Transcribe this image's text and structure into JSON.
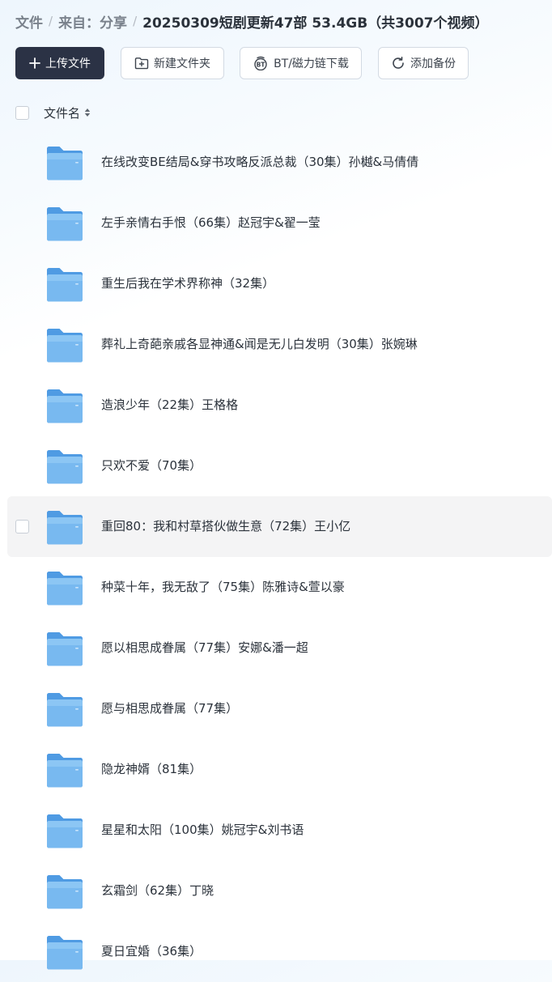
{
  "breadcrumb": {
    "items": [
      "文件",
      "来自：分享"
    ],
    "separator": "/",
    "current": "20250309短剧更新47部 53.4GB（共3007个视频）"
  },
  "toolbar": {
    "upload_label": "上传文件",
    "new_folder_label": "新建文件夹",
    "bt_label": "BT/磁力链下载",
    "backup_label": "添加备份"
  },
  "list_header": {
    "name_label": "文件名"
  },
  "files": [
    {
      "name": "在线改变BE结局&穿书攻略反派总裁（30集）孙樾&马倩倩"
    },
    {
      "name": "左手亲情右手恨（66集）赵冠宇&翟一莹"
    },
    {
      "name": "重生后我在学术界称神（32集）"
    },
    {
      "name": "葬礼上奇葩亲戚各显神通&闻是无儿白发明（30集）张婉琳"
    },
    {
      "name": "造浪少年（22集）王格格"
    },
    {
      "name": "只欢不爱（70集）"
    },
    {
      "name": "重回80：我和村草搭伙做生意（72集）王小亿"
    },
    {
      "name": "种菜十年，我无敌了（75集）陈雅诗&萱以豪"
    },
    {
      "name": "愿以相思成眷属（77集）安娜&潘一超"
    },
    {
      "name": "愿与相思成眷属（77集）"
    },
    {
      "name": "隐龙神婿（81集）"
    },
    {
      "name": "星星和太阳（100集）姚冠宇&刘书语"
    },
    {
      "name": "玄霜剑（62集）丁晓"
    },
    {
      "name": "夏日宜婚（36集）"
    }
  ],
  "hover_index": 6,
  "colors": {
    "primary_button": "#2b3245",
    "folder_blue": "#6fb3ee",
    "hover_row": "#f4f4f5"
  },
  "icons": {
    "upload": "plus-icon",
    "new_folder": "folder-plus-icon",
    "bt": "bt-icon",
    "backup": "sync-icon",
    "sort": "sort-icon",
    "file": "folder-icon"
  }
}
